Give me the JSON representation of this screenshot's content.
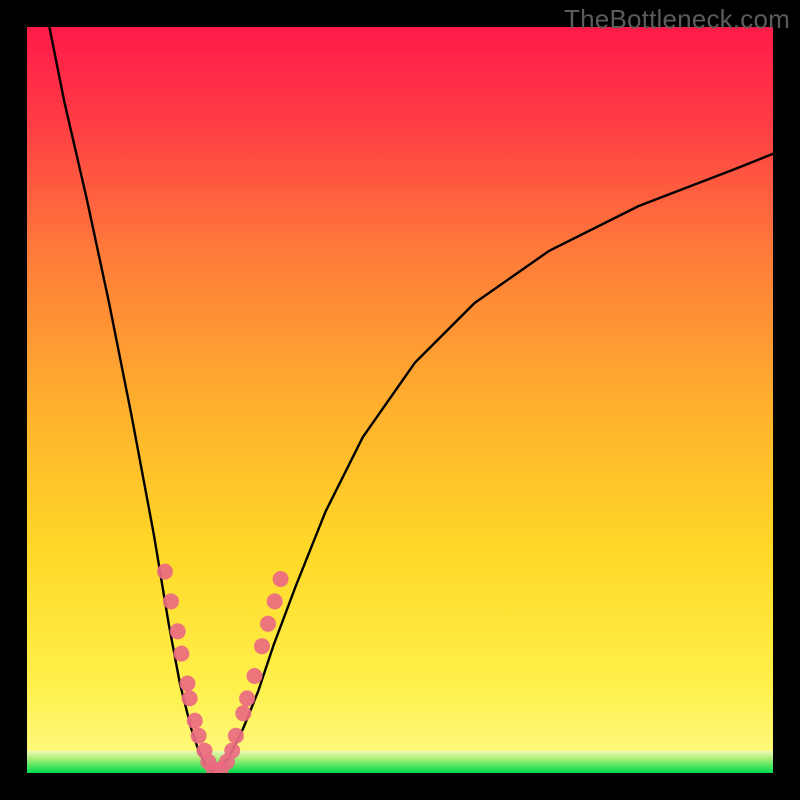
{
  "watermark": "TheBottleneck.com",
  "chart_data": {
    "type": "line",
    "title": "",
    "xlabel": "",
    "ylabel": "",
    "xlim": [
      0,
      100
    ],
    "ylim": [
      0,
      100
    ],
    "grid": false,
    "legend": false,
    "series": [
      {
        "name": "left-curve",
        "x": [
          3,
          5,
          8,
          11,
          14,
          17,
          19,
          20.5,
          22,
          23,
          24,
          25
        ],
        "y": [
          100,
          90,
          77,
          63,
          48,
          32,
          20,
          12,
          6,
          3,
          1,
          0
        ]
      },
      {
        "name": "right-curve",
        "x": [
          25,
          27,
          29,
          31,
          33,
          36,
          40,
          45,
          52,
          60,
          70,
          82,
          95,
          100
        ],
        "y": [
          0,
          2,
          6,
          11,
          17,
          25,
          35,
          45,
          55,
          63,
          70,
          76,
          81,
          83
        ]
      }
    ],
    "markers": {
      "color": "#ea6a81",
      "points": [
        {
          "x": 18.5,
          "y": 27
        },
        {
          "x": 19.3,
          "y": 23
        },
        {
          "x": 20.2,
          "y": 19
        },
        {
          "x": 20.7,
          "y": 16
        },
        {
          "x": 21.5,
          "y": 12
        },
        {
          "x": 21.8,
          "y": 10
        },
        {
          "x": 22.5,
          "y": 7
        },
        {
          "x": 23.0,
          "y": 5
        },
        {
          "x": 23.8,
          "y": 3
        },
        {
          "x": 24.3,
          "y": 1.5
        },
        {
          "x": 25.0,
          "y": 0.5
        },
        {
          "x": 26.0,
          "y": 0.5
        },
        {
          "x": 26.8,
          "y": 1.5
        },
        {
          "x": 27.5,
          "y": 3
        },
        {
          "x": 28.0,
          "y": 5
        },
        {
          "x": 29.0,
          "y": 8
        },
        {
          "x": 29.5,
          "y": 10
        },
        {
          "x": 30.5,
          "y": 13
        },
        {
          "x": 31.5,
          "y": 17
        },
        {
          "x": 32.3,
          "y": 20
        },
        {
          "x": 33.2,
          "y": 23
        },
        {
          "x": 34.0,
          "y": 26
        }
      ]
    },
    "gradient_background": {
      "top_color": "#ff1a49",
      "mid_color": "#ffd400",
      "bottom_color": "#fff97a"
    },
    "green_band": {
      "top_y": 2.5,
      "bottom_y": 0,
      "top_color": "#d3f59a",
      "bottom_color": "#00e24e"
    }
  }
}
